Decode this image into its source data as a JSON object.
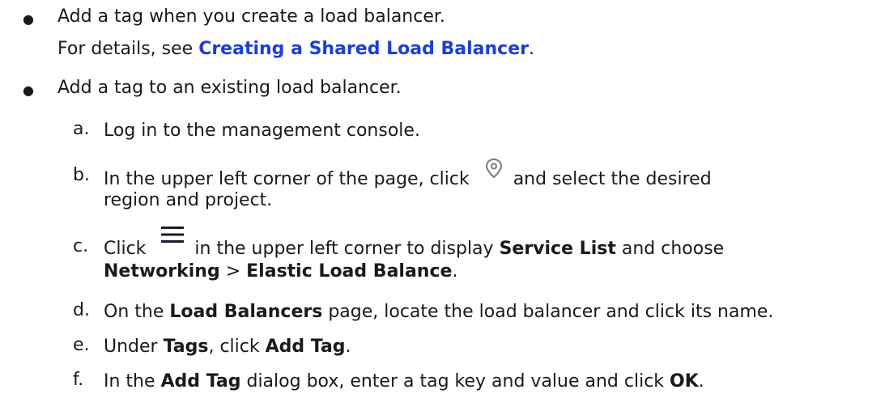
{
  "bullets": [
    {
      "text": "Add a tag when you create a load balancer.",
      "detail_prefix": "For details, see ",
      "detail_link": "Creating a Shared Load Balancer",
      "detail_suffix": "."
    },
    {
      "text": "Add a tag to an existing load balancer."
    }
  ],
  "steps": {
    "a": {
      "marker": "a.",
      "text": "Log in to the management console."
    },
    "b": {
      "marker": "b.",
      "text1": "In the upper left corner of the page, click ",
      "text2": " and select the desired",
      "line2": "region and project.",
      "icon": "location-pin-icon"
    },
    "c": {
      "marker": "c.",
      "text1": "Click ",
      "text2": " in the upper left corner to display ",
      "bold1": "Service List",
      "text3": " and choose",
      "bold2": "Networking",
      "sep": " > ",
      "bold3": "Elastic Load Balance",
      "end": ".",
      "icon": "menu-icon"
    },
    "d": {
      "marker": "d.",
      "text1": "On the ",
      "bold1": "Load Balancers",
      "text2": " page, locate the load balancer and click its name."
    },
    "e": {
      "marker": "e.",
      "text1": "Under ",
      "bold1": "Tags",
      "text2": ", click ",
      "bold2": "Add Tag",
      "end": "."
    },
    "f": {
      "marker": "f.",
      "text1": "In the ",
      "bold1": "Add Tag",
      "text2": " dialog box, enter a tag key and value and click ",
      "bold2": "OK",
      "end": "."
    }
  },
  "colors": {
    "link": "#1a3fd8",
    "text": "#1a1a1a",
    "icon": "#7a7a7a"
  }
}
